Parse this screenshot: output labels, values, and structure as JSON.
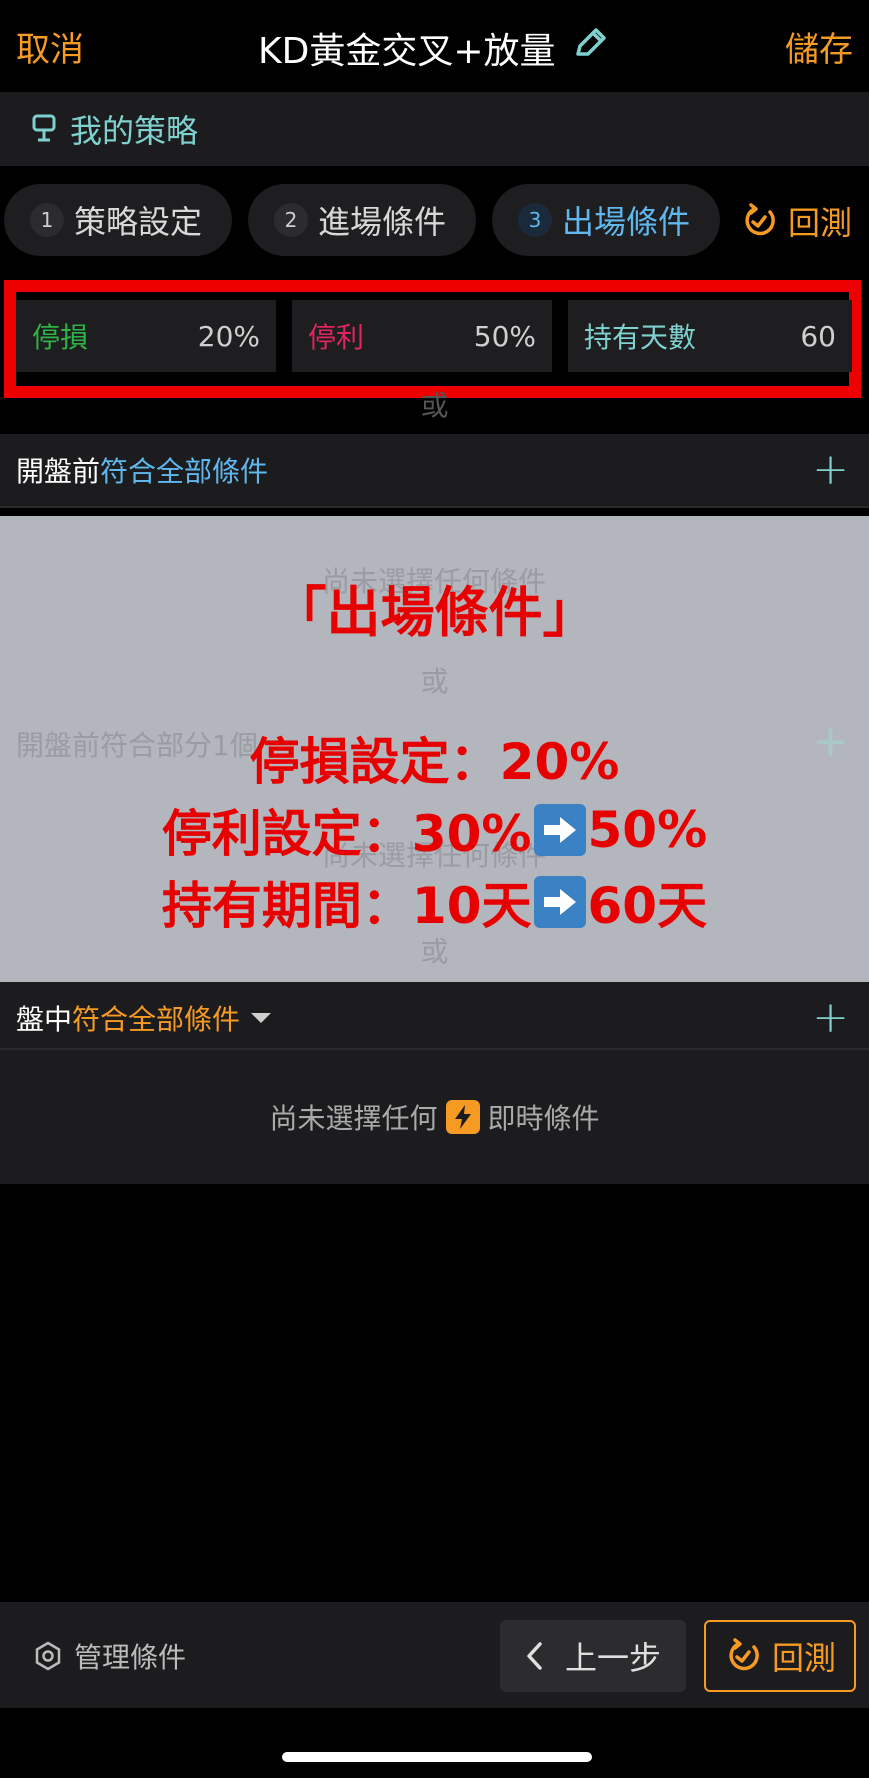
{
  "header": {
    "cancel_label": "取消",
    "title": "KD黃金交叉+放量",
    "save_label": "儲存"
  },
  "strategy_bar": {
    "label": "我的策略"
  },
  "steps": [
    {
      "num": "1",
      "label": "策略設定"
    },
    {
      "num": "2",
      "label": "進場條件"
    },
    {
      "num": "3",
      "label": "出場條件"
    }
  ],
  "backtest_label": "回測",
  "params": {
    "stop_loss": {
      "label": "停損",
      "value": "20%"
    },
    "take_profit": {
      "label": "停利",
      "value": "50%"
    },
    "hold_days": {
      "label": "持有天數",
      "value": "60"
    }
  },
  "or_label": "或",
  "section_pre_all": {
    "prefix": "開盤前",
    "highlight": "符合全部條件"
  },
  "section_pre_partial": {
    "prefix": "開盤前",
    "highlight": "符合部分1個"
  },
  "section_intraday": {
    "prefix": "盤中",
    "highlight": "符合全部條件"
  },
  "ghost_empty": "尚未選擇任何條件",
  "intraday_empty": {
    "before": "尚未選擇任何",
    "after": "即時條件"
  },
  "overlay": {
    "title": "「出場條件」",
    "line1": "停損設定：20%",
    "line2_a": "停利設定：30%",
    "line2_b": "50%",
    "line3_a": "持有期間：10天",
    "line3_b": "60天"
  },
  "bottom": {
    "manage_label": "管理條件",
    "prev_label": "上一步",
    "backtest_label": "回測"
  },
  "colors": {
    "accent_orange": "#f59a23",
    "accent_blue": "#5fb7ee",
    "teal": "#7fd1cf",
    "stop_loss_green": "#2fb344",
    "take_profit_red": "#e0245e",
    "overlay_red": "#e60000"
  }
}
